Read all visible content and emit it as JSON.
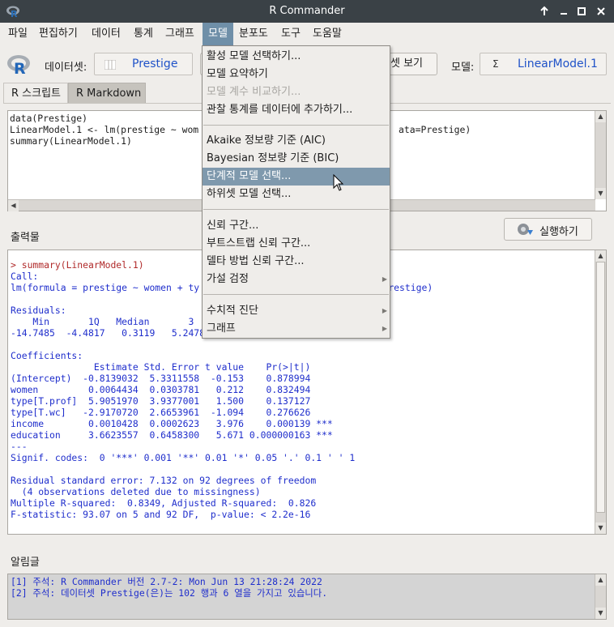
{
  "window": {
    "title": "R Commander"
  },
  "menubar": [
    "파일",
    "편집하기",
    "데이터",
    "통계",
    "그래프",
    "모델",
    "분포도",
    "도구",
    "도움말"
  ],
  "toolbar": {
    "dataset_label": "데이터셋:",
    "dataset_value": "Prestige",
    "view_dataset_partial": "셋 보기",
    "model_label": "모델:",
    "model_value": "LinearModel.1"
  },
  "tabs": [
    "R 스크립트",
    "R Markdown"
  ],
  "script": "data(Prestige)\nLinearModel.1 <- lm(prestige ~ wom                                    ata=Prestige)\nsummary(LinearModel.1)",
  "output_label": "출력물",
  "run_button": "실행하기",
  "output": {
    "command": "> summary(LinearModel.1)",
    "body": "\nCall:\nlm(formula = prestige ~ women + ty                                  restige)\n\nResiduals:\n    Min       1Q   Median       3\n-14.7485  -4.4817   0.3119   5.2478  18.4978\n\nCoefficients:\n               Estimate Std. Error t value    Pr(>|t|)\n(Intercept)  -0.8139032  5.3311558  -0.153    0.878994\nwomen         0.0064434  0.0303781   0.212    0.832494\ntype[T.prof]  5.9051970  3.9377001   1.500    0.137127\ntype[T.wc]   -2.9170720  2.6653961  -1.094    0.276626\nincome        0.0010428  0.0002623   3.976    0.000139 ***\neducation     3.6623557  0.6458300   5.671 0.000000163 ***\n---\nSignif. codes:  0 '***' 0.001 '**' 0.01 '*' 0.05 '.' 0.1 ' ' 1\n\nResidual standard error: 7.132 on 92 degrees of freedom\n  (4 observations deleted due to missingness)\nMultiple R-squared:  0.8349, Adjusted R-squared:  0.826\nF-statistic: 93.07 on 5 and 92 DF,  p-value: < 2.2e-16"
  },
  "messages_label": "알림글",
  "messages": "[1] 주석: R Commander 버전 2.7-2: Mon Jun 13 21:28:24 2022\n[2] 주석: 데이터셋 Prestige(은)는 102 행과 6 열을 가지고 있습니다.",
  "dropdown": [
    "활성 모델 선택하기...",
    "모델 요약하기",
    "모델 계수 비교하기...",
    "관찰 통계를 데이터에 추가하기...",
    "Akaike 정보량 기준 (AIC)",
    "Bayesian 정보량 기준 (BIC)",
    "단계적 모델 선택...",
    "하위셋 모델 선택...",
    "신뢰 구간...",
    "부트스트랩 신뢰 구간...",
    "델타 방법 신뢰 구간...",
    "가설 검정",
    "수치적 진단",
    "그래프"
  ]
}
